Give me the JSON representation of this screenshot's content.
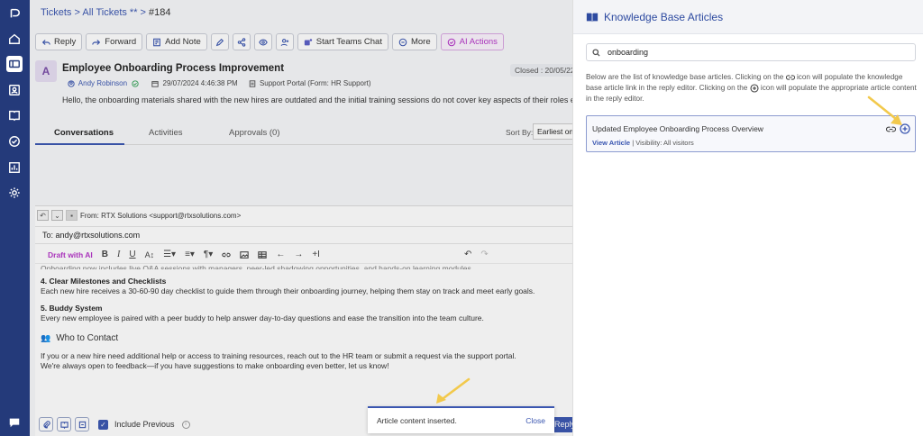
{
  "breadcrumb": {
    "text": "Tickets > All Tickets ** >",
    "ticket_id": "#184"
  },
  "toolbar": {
    "reply": "Reply",
    "forward": "Forward",
    "add_note": "Add Note",
    "teams": "Start Teams Chat",
    "more": "More",
    "ai_actions": "AI Actions"
  },
  "ticket": {
    "avatar": "A",
    "title": "Employee Onboarding Process Improvement",
    "status": "Closed : 20/05/22",
    "user": "Andy Robinson",
    "date": "29/07/2024 4:46:38 PM",
    "source": "Support Portal (Form: HR Support)",
    "description": "Hello, the onboarding materials shared with the new hires are outdated and the initial training sessions do not cover key aspects of their roles effectively"
  },
  "tabs": {
    "conversations": "Conversations",
    "activities": "Activities",
    "approvals": "Approvals (0)"
  },
  "sort": {
    "label": "Sort By:",
    "value": "Earliest on To"
  },
  "editor": {
    "from": "From: RTX Solutions <support@rtxsolutions.com>",
    "to": "To: andy@rtxsolutions.com",
    "draft_ai": "Draft with AI",
    "cut_line": "Onboarding now includes live Q&A sessions with managers, peer-led shadowing opportunities, and hands-on learning modules.",
    "h4": "4. Clear Milestones and Checklists",
    "p4": "Each new hire receives a 30-60-90 day checklist to guide them through their onboarding journey, helping them stay on track and meet early goals.",
    "h5": "5. Buddy System",
    "p5": "Every new employee is paired with a peer buddy to help answer day-to-day questions and ease the transition into the team culture.",
    "contact_heading": "Who to Contact",
    "c1": "If you or a new hire need additional help or access to training resources, reach out to the HR team or submit a request via the support portal.",
    "c2": "We're always open to feedback—if you have suggestions to make onboarding even better, let us know!",
    "include_previous": "Include Previous",
    "reply_btn": "Reply"
  },
  "toast": {
    "message": "Article content inserted.",
    "close": "Close"
  },
  "kb": {
    "title": "Knowledge Base Articles",
    "search_value": "onboarding",
    "explain_1": "Below are the list of knowledge base articles. Clicking on the",
    "explain_2": "icon will populate the knowledge base article link in the reply editor. Clicking on the",
    "explain_3": "icon will populate the appropriate article content in the reply editor.",
    "article_title": "Updated Employee Onboarding Process Overview",
    "view_article": "View Article",
    "visibility": "| Visibility: All visitors"
  },
  "colors": {
    "brand": "#2d4aa0",
    "rail": "#243a7a",
    "ai": "#b535c8",
    "arrow": "#f2c94c"
  }
}
